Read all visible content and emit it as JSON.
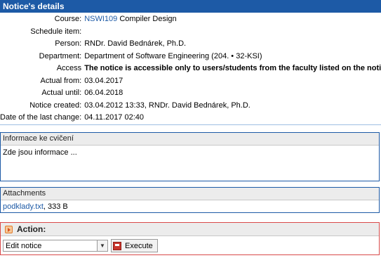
{
  "header": {
    "title": "Notice's details"
  },
  "details": {
    "course": {
      "label": "Course:",
      "code": "NSWI109",
      "name": " Compiler Design"
    },
    "schedule": {
      "label": "Schedule item:",
      "value": ""
    },
    "person": {
      "label": "Person:",
      "value": "RNDr. David Bednárek, Ph.D."
    },
    "department": {
      "label": "Department:",
      "value": "Department of Software Engineering (204. • 32-KSI)"
    },
    "access": {
      "label": "Access",
      "value": "The notice is accessible only to users/students from the faculty listed on the notice."
    },
    "actual_from": {
      "label": "Actual from:",
      "value": "03.04.2017"
    },
    "actual_until": {
      "label": "Actual until:",
      "value": "06.04.2018"
    },
    "created": {
      "label": "Notice created:",
      "value": "03.04.2012 13:33, RNDr. David Bednárek, Ph.D."
    },
    "last_change": {
      "label": "Date of the last change:",
      "value": "04.11.2017 02:40"
    }
  },
  "info_box": {
    "title": "Informace ke cvičení",
    "text": "Zde jsou informace ..."
  },
  "attachments": {
    "title": "Attachments",
    "file": "podklady.txt",
    "size": ", 333 B"
  },
  "action": {
    "title": "Action:",
    "selected": "Edit notice",
    "execute_label": "Execute",
    "icon": "play-icon",
    "accent": "#d94a4a"
  },
  "colors": {
    "brand": "#1d5aa6",
    "link": "#1d5aa6"
  }
}
